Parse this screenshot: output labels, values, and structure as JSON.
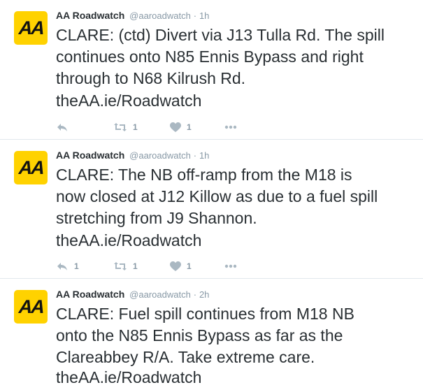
{
  "tweets": [
    {
      "name": "AA Roadwatch",
      "handle": "@aaroadwatch",
      "dot": "·",
      "time": "1h",
      "avatar_text": "AA",
      "lines": [
        "CLARE: (ctd) Divert via J13 Tulla Rd. The spill",
        "continues onto N85 Ennis Bypass and right",
        "through to N68 Kilrush Rd."
      ],
      "link": "theAA.ie/Roadwatch",
      "reply_count": "",
      "retweet_count": "1",
      "like_count": "1"
    },
    {
      "name": "AA Roadwatch",
      "handle": "@aaroadwatch",
      "dot": "·",
      "time": "1h",
      "avatar_text": "AA",
      "lines": [
        "CLARE: The NB off-ramp from the M18 is",
        "now closed at J12 Killow as due to a fuel spill",
        "stretching from J9 Shannon."
      ],
      "link": "theAA.ie/Roadwatch",
      "reply_count": "1",
      "retweet_count": "1",
      "like_count": "1"
    },
    {
      "name": "AA Roadwatch",
      "handle": "@aaroadwatch",
      "dot": "·",
      "time": "2h",
      "avatar_text": "AA",
      "lines": [
        "CLARE: Fuel spill continues from M18 NB",
        "onto the N85 Ennis Bypass as far as the",
        "Clareabbey R/A. Take extreme care."
      ],
      "link": "theAA.ie/Roadwatch"
    }
  ],
  "icons": {
    "reply": "reply-icon",
    "retweet": "retweet-icon",
    "like": "heart-icon",
    "more": "more-icon"
  },
  "colors": {
    "avatar_background": "#ffd200",
    "text": "#292f33",
    "meta": "#8899a6",
    "icon": "#aab8c2",
    "divider": "#e1e8ed"
  }
}
